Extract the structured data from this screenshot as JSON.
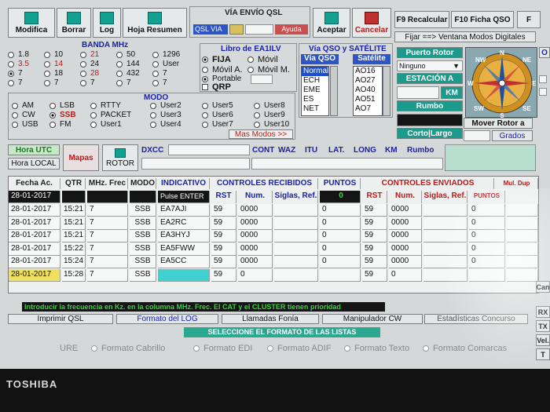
{
  "toolbar": {
    "modifica": "Modifica",
    "borrar": "Borrar",
    "log": "Log",
    "hoja_resumen": "Hoja Resumen",
    "aceptar": "Aceptar",
    "cancelar": "Cancelar",
    "f9": "F9 Recalcular",
    "f10": "F10 Ficha QSO",
    "fijar": "Fijar ==> Ventana Modos Digitales",
    "r_edge": "O"
  },
  "via_envio": {
    "title": "VÍA ENVÍO QSL",
    "qsl_via": "QSL VIA",
    "ayuda": "Ayuda"
  },
  "banda": {
    "title": "BANDA MHz",
    "items": [
      {
        "label": "1.8"
      },
      {
        "label": "10"
      },
      {
        "label": "21",
        "red": true
      },
      {
        "label": "50"
      },
      {
        "label": "1296"
      },
      {
        "label": "3.5",
        "red": true
      },
      {
        "label": "14",
        "red": true
      },
      {
        "label": "24"
      },
      {
        "label": "144"
      },
      {
        "label": "User"
      },
      {
        "label": "7",
        "on": true
      },
      {
        "label": "18"
      },
      {
        "label": "28",
        "red": true
      },
      {
        "label": "432"
      },
      {
        "label": "7"
      },
      {
        "label": "7"
      },
      {
        "label": "7"
      },
      {
        "label": "7"
      },
      {
        "label": "7"
      },
      {
        "label": "7"
      }
    ]
  },
  "libro": {
    "title": "Libro de EA1ILV",
    "fija": "FIJA",
    "movil": "Móvil",
    "movil_a": "Móvil A.",
    "movil_m": "Móvil M.",
    "portable": "Portable",
    "qrp": "QRP"
  },
  "modo": {
    "title": "MODO",
    "items": [
      {
        "label": "AM"
      },
      {
        "label": "LSB"
      },
      {
        "label": "RTTY"
      },
      {
        "label": "User2"
      },
      {
        "label": "User5"
      },
      {
        "label": "User8"
      },
      {
        "label": "CW"
      },
      {
        "label": "SSB",
        "red": true,
        "on": true
      },
      {
        "label": "PACKET"
      },
      {
        "label": "User3"
      },
      {
        "label": "User6"
      },
      {
        "label": "User9"
      },
      {
        "label": "USB"
      },
      {
        "label": "FM"
      },
      {
        "label": "User1"
      },
      {
        "label": "User4"
      },
      {
        "label": "User7"
      },
      {
        "label": "User10"
      }
    ],
    "mas_modos": "Mas Modos >>"
  },
  "via_qso": {
    "title": "Vía QSO y SATÉLITE",
    "via_hdr": "Vía QSO",
    "sat_hdr": "Satélite",
    "via_items": [
      "Normal",
      "ECH",
      "EME",
      "ES",
      "NET"
    ],
    "sat_items": [
      "AO16",
      "AO27",
      "AO40",
      "AO51",
      "AO7"
    ]
  },
  "rotor": {
    "puerto": "Puerto Rotor",
    "ninguno": "Ninguno",
    "estacion": "ESTACIÓN A",
    "km": "KM",
    "rumbo": "Rumbo",
    "corto_largo": "Corto|Largo",
    "mover": "Mover Rotor a",
    "grados": "Grados",
    "compass": [
      "N",
      "NW",
      "NE",
      "W",
      "E",
      "SW",
      "SE",
      "S"
    ]
  },
  "infobar": {
    "hora_utc": "Hora UTC",
    "hora_local": "Hora LOCAL",
    "mapas": "Mapas",
    "rotor": "ROTOR",
    "dxcc": "DXCC",
    "cont": "CONT",
    "waz": "WAZ",
    "itu": "ITU",
    "lat": "LAT.",
    "long": "LONG",
    "km": "KM",
    "rumbo": "Rumbo"
  },
  "table": {
    "headers": {
      "fecha": "Fecha Ac.",
      "qtr": "QTR",
      "mhz": "MHz. Frec",
      "modo": "MODO",
      "indicativo": "INDICATIVO",
      "controles_recibidos": "CONTROLES RECIBIDOS",
      "puntos": "PUNTOS",
      "controles_enviados": "CONTROLES ENVIADOS",
      "mul_dup": "Mul. Dup",
      "rst": "RST",
      "num": "Num.",
      "siglas": "Siglas, Ref.",
      "rst2": "RST",
      "num2": "Num.",
      "siglas2": "Siglas, Ref.",
      "puntos2": "PUNTOS"
    },
    "input_row": {
      "fecha": "28-01-2017",
      "indicativo": "Pulse ENTER",
      "puntos": "0"
    },
    "rows": [
      {
        "fecha": "28-01-2017",
        "qtr": "15:21",
        "mhz": "7",
        "modo": "SSB",
        "ind": "EA7AJI",
        "rst": "59",
        "num": "0000",
        "sig": "",
        "pts": "0",
        "rst2": "59",
        "num2": "0000",
        "sig2": "",
        "pts2": "0"
      },
      {
        "fecha": "28-01-2017",
        "qtr": "15:21",
        "mhz": "7",
        "modo": "SSB",
        "ind": "EA2RC",
        "rst": "59",
        "num": "0000",
        "sig": "",
        "pts": "0",
        "rst2": "59",
        "num2": "0000",
        "sig2": "",
        "pts2": "0"
      },
      {
        "fecha": "28-01-2017",
        "qtr": "15:21",
        "mhz": "7",
        "modo": "SSB",
        "ind": "EA3HYJ",
        "rst": "59",
        "num": "0000",
        "sig": "",
        "pts": "0",
        "rst2": "59",
        "num2": "0000",
        "sig2": "",
        "pts2": "0"
      },
      {
        "fecha": "28-01-2017",
        "qtr": "15:22",
        "mhz": "7",
        "modo": "SSB",
        "ind": "EA5FWW",
        "rst": "59",
        "num": "0000",
        "sig": "",
        "pts": "0",
        "rst2": "59",
        "num2": "0000",
        "sig2": "",
        "pts2": "0"
      },
      {
        "fecha": "28-01-2017",
        "qtr": "15:24",
        "mhz": "7",
        "modo": "SSB",
        "ind": "EA5CC",
        "rst": "59",
        "num": "0000",
        "sig": "",
        "pts": "0",
        "rst2": "59",
        "num2": "0000",
        "sig2": "",
        "pts2": "0"
      },
      {
        "fecha": "28-01-2017",
        "qtr": "15:28",
        "mhz": "7",
        "modo": "SSB",
        "ind": "",
        "rst": "59",
        "num": "0",
        "sig": "",
        "pts": "",
        "rst2": "59",
        "num2": "0",
        "sig2": "",
        "pts2": ""
      }
    ]
  },
  "bottom": {
    "hint": "Introducir la frecuencia en Kz. en la columna MHz. Frec. El CAT y el CLUSTER tienen prioridad",
    "imprimir": "Imprimir QSL",
    "formato_log": "Formato del LOG",
    "llamadas": "Llamadas Fonía",
    "manipulador": "Manipulador CW",
    "estadisticas": "Estadísticas Concurso",
    "seleccione": "SELECCIONE EL FORMATO DE LAS LISTAS",
    "formatos": [
      "Formato Cabrillo",
      "Formato EDI",
      "Formato ADIF",
      "Formato Texto",
      "Formato Comarcas"
    ],
    "formato_ure": "URE"
  },
  "right_edge": [
    "Can",
    "RX",
    "TX",
    "Vel.",
    "T"
  ],
  "brand": "TOSHIBA"
}
